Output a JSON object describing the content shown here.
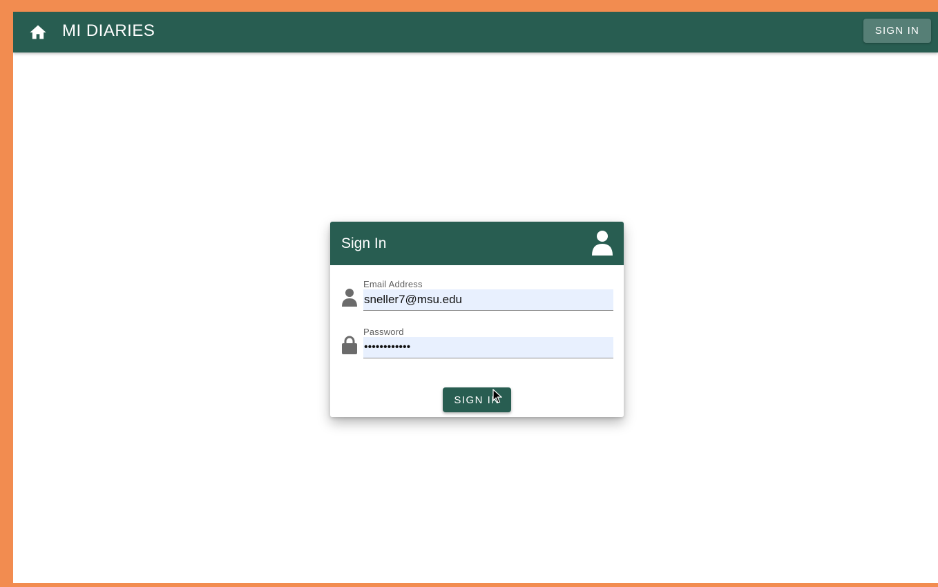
{
  "appbar": {
    "home_icon": "home-icon",
    "title": "MI DIARIES",
    "signin_label": "SIGN IN"
  },
  "signin_card": {
    "title": "Sign In",
    "header_icon": "person-icon",
    "email": {
      "icon": "person-icon",
      "label": "Email Address",
      "value": "sneller7@msu.edu"
    },
    "password": {
      "icon": "lock-icon",
      "label": "Password",
      "value": "••••••••••••"
    },
    "submit_label": "SIGN IN"
  },
  "colors": {
    "frame": "#f28c50",
    "primary": "#285d51",
    "appbar_button": "#567f76",
    "autofill": "#e8f0fe"
  }
}
